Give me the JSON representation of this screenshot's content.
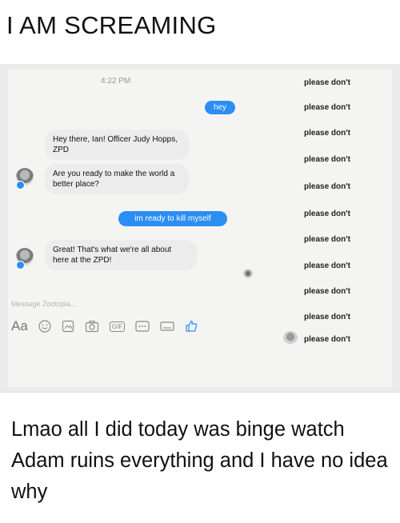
{
  "title": "I AM SCREAMING",
  "chat": {
    "timestamp": "4:22 PM",
    "messages": [
      {
        "from": "me",
        "text": "hey"
      },
      {
        "from": "them",
        "text": "Hey there, Ian! Officer Judy Hopps, ZPD"
      },
      {
        "from": "them",
        "text": "Are you ready to make the world a better place?"
      },
      {
        "from": "me",
        "text": "im ready to kill myself"
      },
      {
        "from": "them",
        "text": "Great! That's what we're all about here at the ZPD!"
      }
    ],
    "input_placeholder": "Message Zootopia...",
    "toolbar": {
      "aa": "Aa",
      "gif": "GIF"
    }
  },
  "right_messages": [
    "please don't",
    "please don't",
    "please don't",
    "please don't",
    "please don't",
    "please don't",
    "please don't",
    "please don't",
    "please don't",
    "please don't",
    "please don't"
  ],
  "caption": "Lmao all I did today was binge watch Adam ruins everything and I have no idea why",
  "colors": {
    "accent_blue": "#2b8ef3",
    "bubble_gray": "#ececec"
  }
}
